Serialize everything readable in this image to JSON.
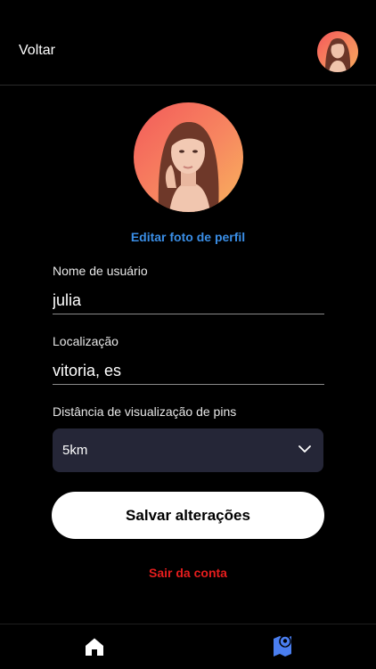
{
  "header": {
    "back_label": "Voltar"
  },
  "profile": {
    "edit_photo_label": "Editar foto de perfil"
  },
  "form": {
    "username_label": "Nome de usuário",
    "username_value": "julia",
    "location_label": "Localização",
    "location_value": "vitoria, es",
    "distance_label": "Distância de visualização de pins",
    "distance_value": "5km"
  },
  "actions": {
    "save_label": "Salvar alterações",
    "logout_label": "Sair da conta"
  },
  "tabs": [
    {
      "icon": "home-icon",
      "active": false
    },
    {
      "icon": "map-pin-icon",
      "active": true
    }
  ],
  "colors": {
    "accent_link": "#3a8ee6",
    "danger": "#e51d1d",
    "select_bg": "#252637",
    "active_tab": "#4a7ef0"
  }
}
